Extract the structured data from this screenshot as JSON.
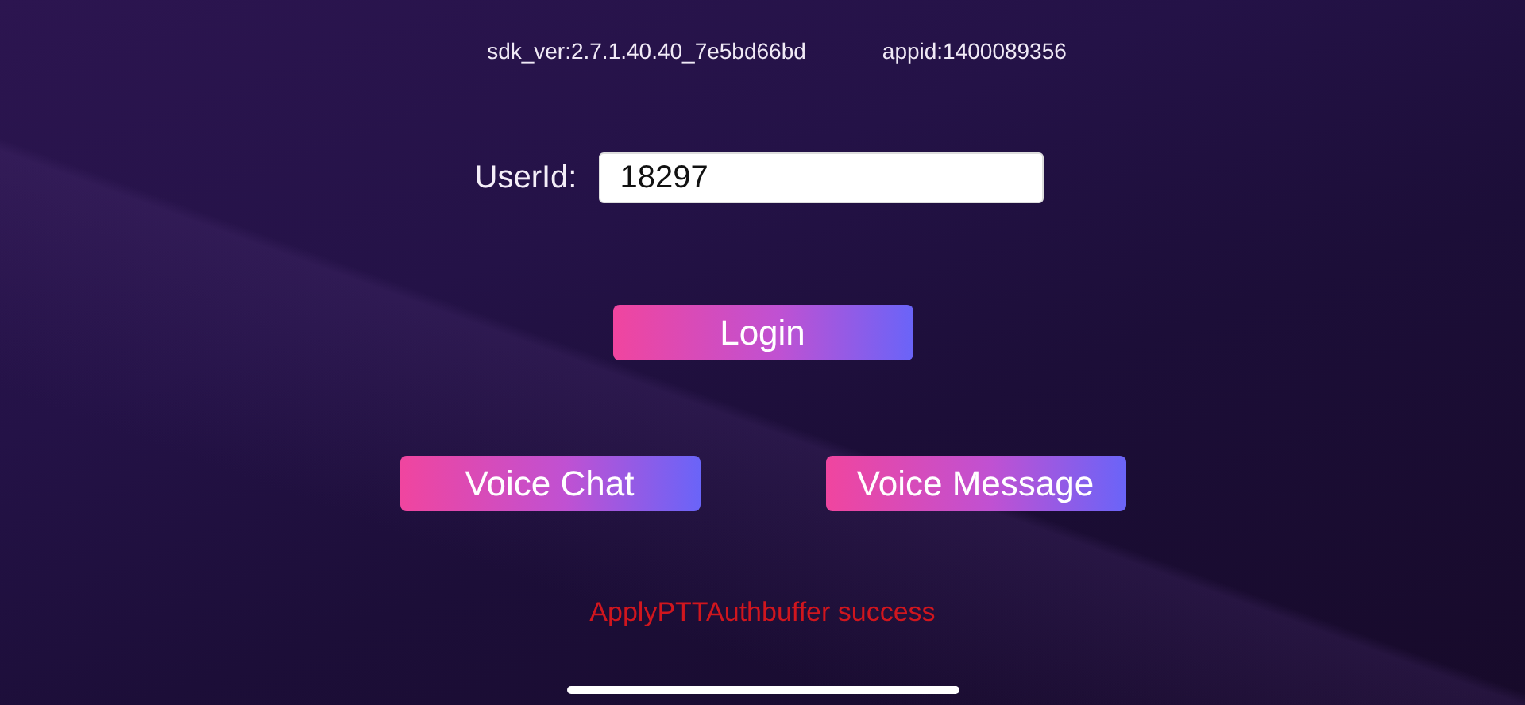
{
  "header": {
    "sdk_version": "sdk_ver:2.7.1.40.40_7e5bd66bd",
    "appid": "appid:1400089356"
  },
  "user_id": {
    "label": "UserId:",
    "value": "18297"
  },
  "buttons": [
    {
      "label": "Login"
    },
    {
      "label": "Voice Chat"
    },
    {
      "label": "Voice Message"
    }
  ],
  "status": "ApplyPTTAuthbuffer success"
}
